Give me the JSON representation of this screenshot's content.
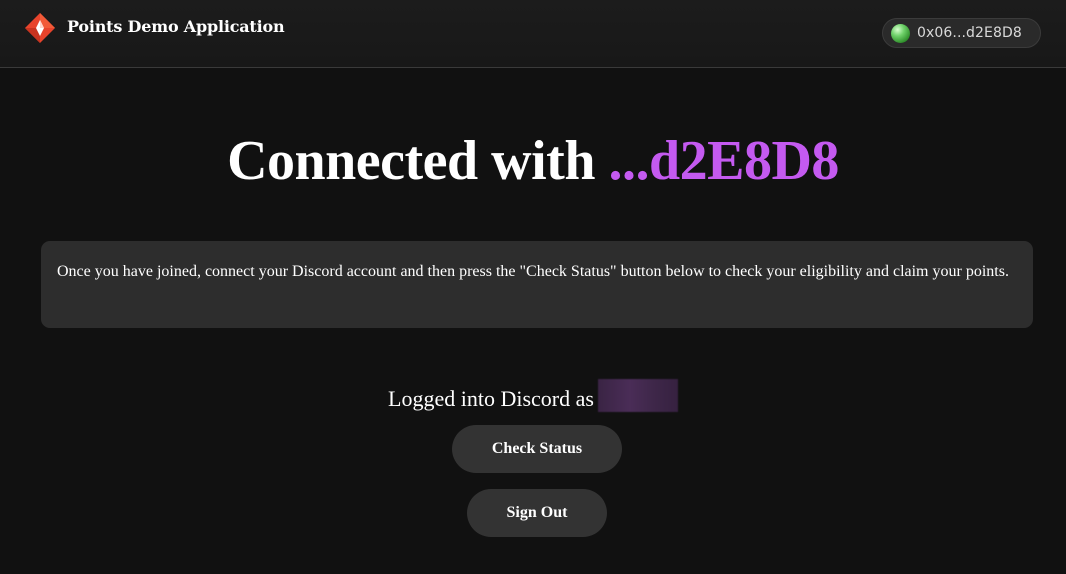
{
  "header": {
    "logo_icon": "points-diamond-logo-icon",
    "title": "Points Demo Application",
    "wallet": {
      "address": "0x06...d2E8D8",
      "status_color": "#4cbf46"
    }
  },
  "hero": {
    "prefix": "Connected with ",
    "address_short": "...d2E8D8",
    "accent_color": "#c45af0"
  },
  "info": {
    "text": "Once you have joined, connect your Discord account and then press the \"Check Status\" button below to check your eligibility and claim your points."
  },
  "discord": {
    "logged_in_label": "Logged into Discord as"
  },
  "actions": {
    "check_status_label": "Check Status",
    "sign_out_label": "Sign Out"
  }
}
